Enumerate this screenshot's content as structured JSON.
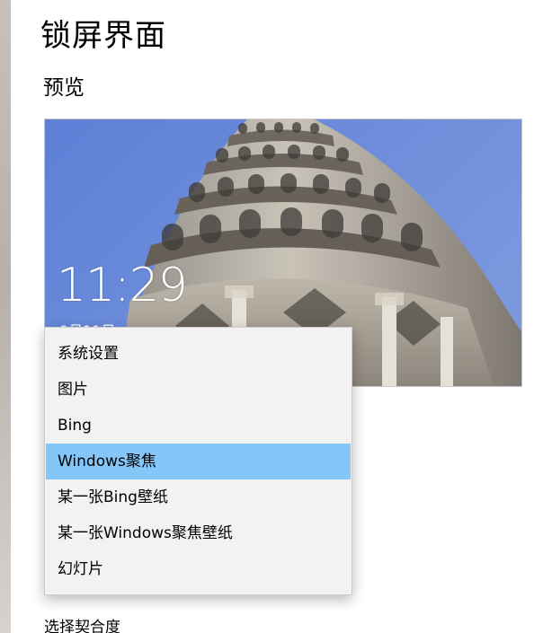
{
  "page": {
    "title": "锁屏界面",
    "section_preview": "预览"
  },
  "preview": {
    "time": "11:29",
    "date_partial": "9月11日"
  },
  "dropdown": {
    "items": [
      {
        "label": "系统设置"
      },
      {
        "label": "图片"
      },
      {
        "label": "Bing"
      },
      {
        "label": "Windows聚焦",
        "selected": true
      },
      {
        "label": "某一张Bing壁纸"
      },
      {
        "label": "某一张Windows聚焦壁纸"
      },
      {
        "label": "幻灯片"
      }
    ],
    "highlight_color": "#84c6f8"
  },
  "fit": {
    "label": "选择契合度"
  }
}
